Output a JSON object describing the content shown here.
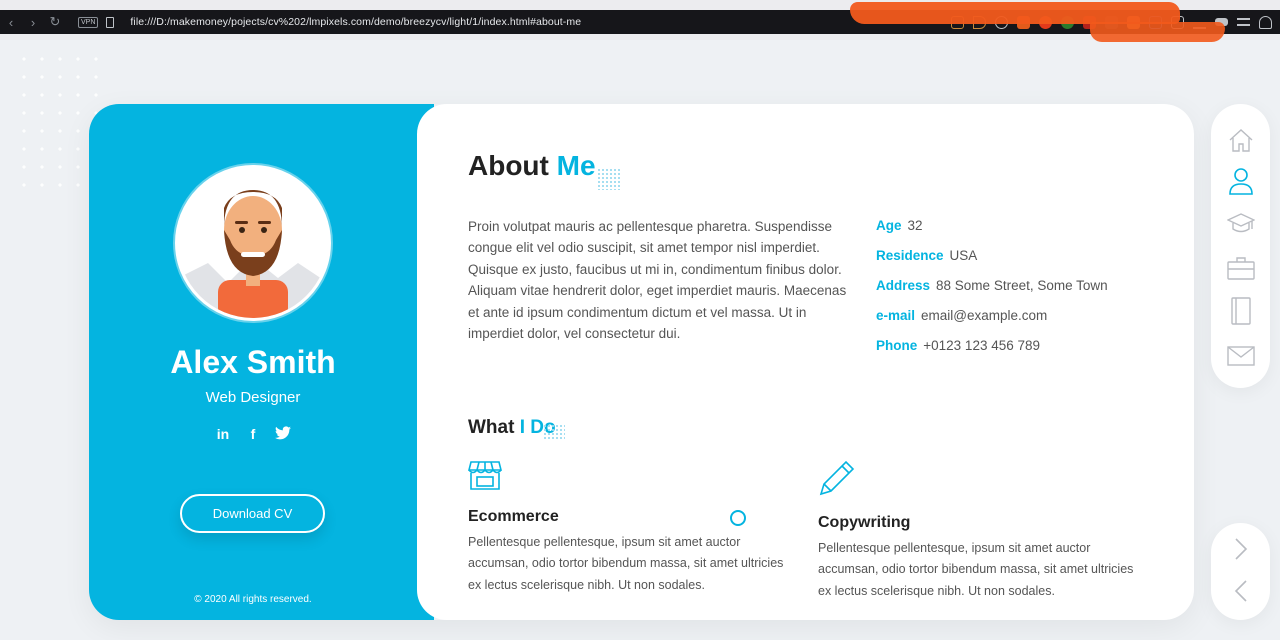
{
  "browser": {
    "vpn_label": "VPN",
    "url": "file:///D:/makemoney/pojects/cv%202/lmpixels.com/demo/breezycv/light/1/index.html#about-me"
  },
  "colors": {
    "accent": "#04b4e0",
    "profile_bg": "#04b4e0",
    "text": "#555555",
    "heading": "#222222"
  },
  "profile": {
    "name": "Alex Smith",
    "role": "Web Designer",
    "social": {
      "linkedin": "in",
      "facebook": "f",
      "twitter": "twitter-icon"
    },
    "download_label": "Download CV",
    "copyright": "© 2020 All rights reserved."
  },
  "about": {
    "title_plain": "About ",
    "title_accent": "Me",
    "description": "Proin volutpat mauris ac pellentesque pharetra. Suspendisse congue elit vel odio suscipit, sit amet tempor nisl imperdiet. Quisque ex justo, faucibus ut mi in, condimentum finibus dolor. Aliquam vitae hendrerit dolor, eget imperdiet mauris. Maecenas et ante id ipsum condimentum dictum et vel massa. Ut in imperdiet dolor, vel consectetur dui.",
    "info": [
      {
        "label": "Age",
        "value": "32"
      },
      {
        "label": "Residence",
        "value": "USA"
      },
      {
        "label": "Address",
        "value": "88 Some Street, Some Town"
      },
      {
        "label": "e-mail",
        "value": "email@example.com"
      },
      {
        "label": "Phone",
        "value": "+0123 123 456 789"
      }
    ]
  },
  "what_i_do": {
    "title_plain": "What ",
    "title_accent": "I Do",
    "services": [
      {
        "icon": "store-icon",
        "title": "Ecommerce",
        "text": "Pellentesque pellentesque, ipsum sit amet auctor accumsan, odio tortor bibendum massa, sit amet ultricies ex lectus scelerisque nibh. Ut non sodales."
      },
      {
        "icon": "pencil-icon",
        "title": "Copywriting",
        "text": "Pellentesque pellentesque, ipsum sit amet auctor accumsan, odio tortor bibendum massa, sit amet ultricies ex lectus scelerisque nibh. Ut non sodales."
      }
    ]
  },
  "nav": {
    "items": [
      {
        "icon": "home-icon",
        "active": false
      },
      {
        "icon": "user-icon",
        "active": true
      },
      {
        "icon": "graduation-cap-icon",
        "active": false
      },
      {
        "icon": "briefcase-icon",
        "active": false
      },
      {
        "icon": "book-icon",
        "active": false
      },
      {
        "icon": "envelope-icon",
        "active": false
      }
    ],
    "arrows": [
      "chevron-right-icon",
      "chevron-left-icon"
    ]
  }
}
